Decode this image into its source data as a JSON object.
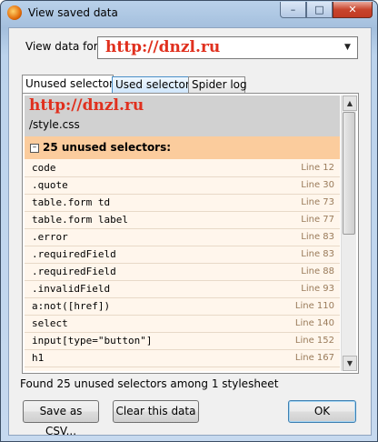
{
  "window": {
    "title": "View saved data",
    "minimize": "–",
    "maximize": "□",
    "close": "✕"
  },
  "view_data": {
    "label": "View data for:",
    "selected": "http://dnzl.ru"
  },
  "tabs": [
    {
      "label": "Unused selectors"
    },
    {
      "label": "Used selectors"
    },
    {
      "label": "Spider log"
    }
  ],
  "site": {
    "url": "http://dnzl.ru",
    "file": "/style.css"
  },
  "group": {
    "toggle": "–",
    "title": "25 unused selectors:"
  },
  "rows": [
    {
      "selector": "code",
      "line": "Line 12"
    },
    {
      "selector": ".quote",
      "line": "Line 30"
    },
    {
      "selector": "table.form td",
      "line": "Line 73"
    },
    {
      "selector": "table.form label",
      "line": "Line 77"
    },
    {
      "selector": ".error",
      "line": "Line 83"
    },
    {
      "selector": ".requiredField",
      "line": "Line 83"
    },
    {
      "selector": ".requiredField",
      "line": "Line 88"
    },
    {
      "selector": ".invalidField",
      "line": "Line 93"
    },
    {
      "selector": "a:not([href])",
      "line": "Line 110"
    },
    {
      "selector": "select",
      "line": "Line 140"
    },
    {
      "selector": "input[type=\"button\"]",
      "line": "Line 152"
    },
    {
      "selector": "h1",
      "line": "Line 167"
    }
  ],
  "status": "Found 25 unused selectors among 1 stylesheet",
  "buttons": {
    "save_csv": "Save as CSV...",
    "clear": "Clear this data",
    "ok": "OK"
  },
  "icons": {
    "app": "firefox-icon",
    "dropdown": "chevron-down-icon",
    "collapse": "minus-box-icon"
  }
}
